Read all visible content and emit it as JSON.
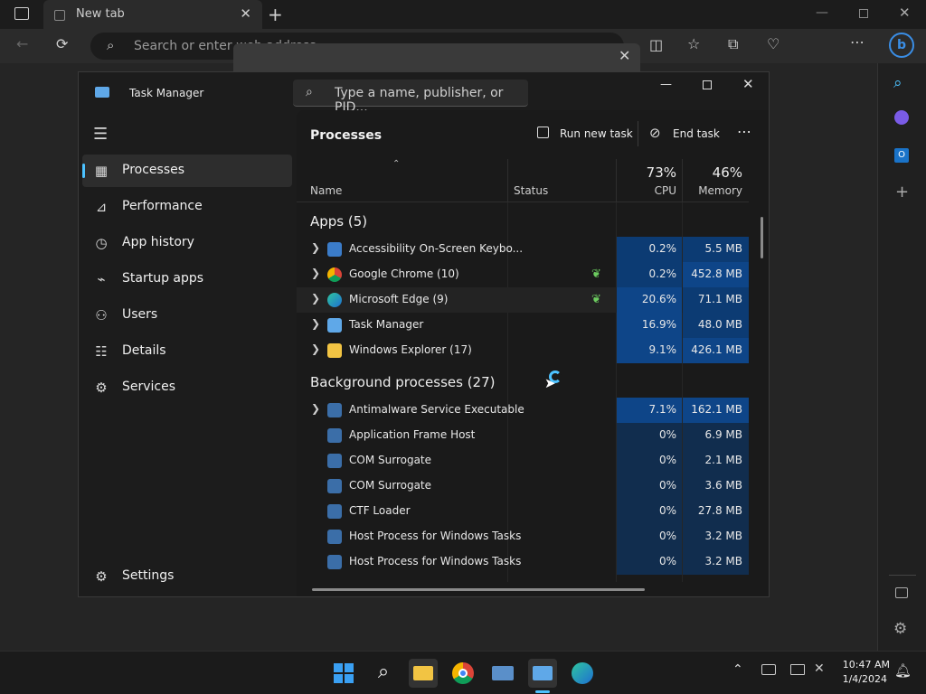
{
  "browser": {
    "tab_title": "New tab",
    "address_placeholder": "Search or enter web address"
  },
  "task_manager": {
    "title": "Task Manager",
    "search_placeholder": "Type a name, publisher, or PID...",
    "nav": [
      {
        "label": "Processes",
        "icon": "processes-icon"
      },
      {
        "label": "Performance",
        "icon": "performance-icon"
      },
      {
        "label": "App history",
        "icon": "app-history-icon"
      },
      {
        "label": "Startup apps",
        "icon": "startup-apps-icon"
      },
      {
        "label": "Users",
        "icon": "users-icon"
      },
      {
        "label": "Details",
        "icon": "details-icon"
      },
      {
        "label": "Services",
        "icon": "services-icon"
      }
    ],
    "settings_label": "Settings",
    "page_title": "Processes",
    "run_new_task": "Run new task",
    "end_task": "End task",
    "columns": {
      "name": "Name",
      "status": "Status",
      "cpu_pct": "73%",
      "cpu": "CPU",
      "mem_pct": "46%",
      "memory": "Memory"
    },
    "apps_group": "Apps (5)",
    "apps": [
      {
        "name": "Accessibility On-Screen Keybo...",
        "cpu": "0.2%",
        "mem": "5.5 MB",
        "eco": false
      },
      {
        "name": "Google Chrome (10)",
        "cpu": "0.2%",
        "mem": "452.8 MB",
        "eco": true
      },
      {
        "name": "Microsoft Edge (9)",
        "cpu": "20.6%",
        "mem": "71.1 MB",
        "eco": true
      },
      {
        "name": "Task Manager",
        "cpu": "16.9%",
        "mem": "48.0 MB",
        "eco": false
      },
      {
        "name": "Windows Explorer (17)",
        "cpu": "9.1%",
        "mem": "426.1 MB",
        "eco": false
      }
    ],
    "bg_group": "Background processes (27)",
    "background": [
      {
        "name": "Antimalware Service Executable",
        "cpu": "7.1%",
        "mem": "162.1 MB",
        "expand": true
      },
      {
        "name": "Application Frame Host",
        "cpu": "0%",
        "mem": "6.9 MB",
        "expand": false
      },
      {
        "name": "COM Surrogate",
        "cpu": "0%",
        "mem": "2.1 MB",
        "expand": false
      },
      {
        "name": "COM Surrogate",
        "cpu": "0%",
        "mem": "3.6 MB",
        "expand": false
      },
      {
        "name": "CTF Loader",
        "cpu": "0%",
        "mem": "27.8 MB",
        "expand": false
      },
      {
        "name": "Host Process for Windows Tasks",
        "cpu": "0%",
        "mem": "3.2 MB",
        "expand": false
      },
      {
        "name": "Host Process for Windows Tasks",
        "cpu": "0%",
        "mem": "3.2 MB",
        "expand": false
      }
    ]
  },
  "taskbar": {
    "time": "10:47 AM",
    "date": "1/4/2024"
  },
  "colors": {
    "accent": "#4cc2ff",
    "cpu_highlight": "#0e4588",
    "eco_leaf": "#6ccb5f"
  }
}
